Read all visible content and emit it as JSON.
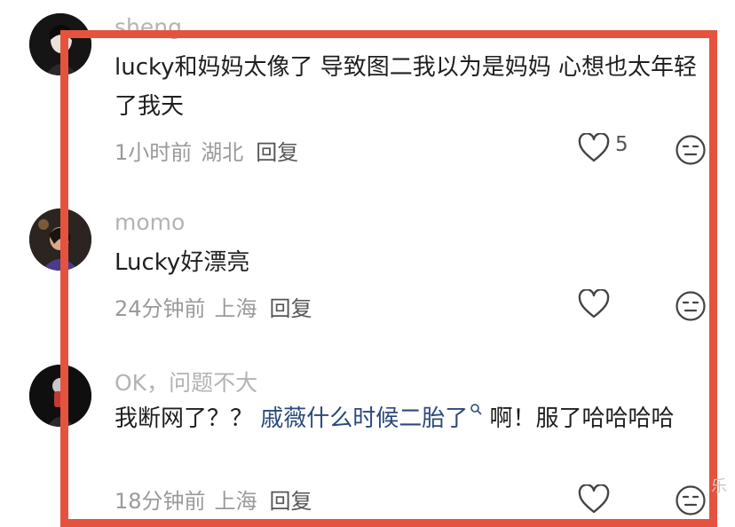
{
  "comments": [
    {
      "username": "sheng",
      "text": "lucky和妈妈太像了 导致图二我以为是妈妈 心想也太年轻了我天",
      "time": "1小时前",
      "location": "湖北",
      "reply": "回复",
      "likes": "5"
    },
    {
      "username": "momo",
      "text": "Lucky好漂亮",
      "time": "24分钟前",
      "location": "上海",
      "reply": "回复"
    },
    {
      "username": "OK，问题不大",
      "text_before": "我断网了？？ ",
      "mention": "戚薇什么时候二胎了",
      "text_after": " 啊！服了哈哈哈哈",
      "time": "18分钟前",
      "location": "上海",
      "reply": "回复"
    }
  ],
  "icons": {
    "like": "heart-outline-icon",
    "emoji": "neutral-face-icon",
    "mention": "search-icon"
  },
  "colors": {
    "highlight_frame": "#e5533f",
    "mention": "#2c4a7a",
    "username": "#b3b3b3",
    "meta": "#9a9a9a"
  },
  "watermark": "乐"
}
